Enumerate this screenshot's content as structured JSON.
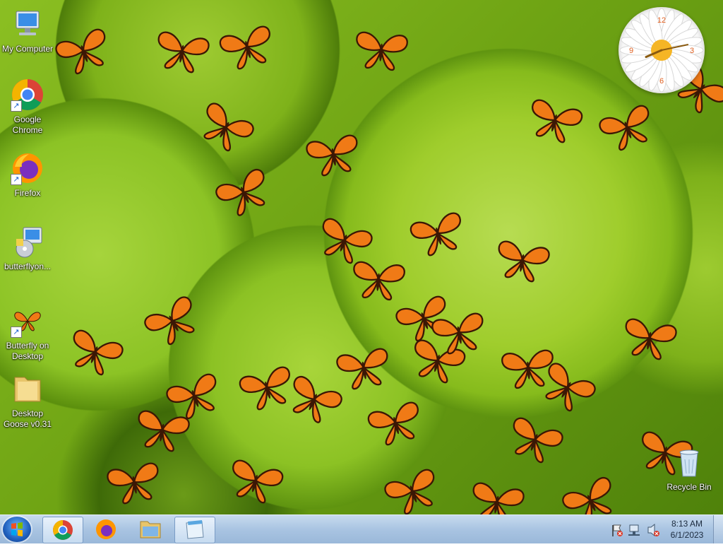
{
  "desktop": {
    "icons": [
      {
        "label": "My Computer",
        "icon": "computer-icon"
      },
      {
        "label": "Google Chrome",
        "icon": "chrome-icon"
      },
      {
        "label": "Firefox",
        "icon": "firefox-icon"
      },
      {
        "label": "butterflyon...",
        "icon": "installer-icon"
      },
      {
        "label": "Butterfly on Desktop",
        "icon": "butterfly-icon"
      },
      {
        "label": "Desktop Goose v0.31",
        "icon": "folder-icon"
      }
    ],
    "recycle_bin": {
      "label": "Recycle Bin",
      "icon": "recycle-bin-icon"
    }
  },
  "clock_widget": {
    "numerals": [
      "12",
      "3",
      "6",
      "9"
    ],
    "time": "8:13"
  },
  "taskbar": {
    "start": {
      "icon": "windows-start-icon"
    },
    "pinned": [
      {
        "name": "Google Chrome",
        "icon": "chrome-icon",
        "active": true
      },
      {
        "name": "Firefox",
        "icon": "firefox-icon",
        "active": false
      },
      {
        "name": "File Explorer",
        "icon": "folder-icon",
        "active": false
      },
      {
        "name": "Notepad",
        "icon": "notepad-icon",
        "active": true
      }
    ],
    "tray": {
      "icons": [
        "action-center-flag-icon",
        "network-icon",
        "volume-muted-icon"
      ],
      "time": "8:13 AM",
      "date": "6/1/2023"
    }
  },
  "colors": {
    "butterfly": "#f07a16",
    "butterfly_vein": "#3b1705",
    "taskbar": "#a9c4e2",
    "wallpaper": "#8bbf22"
  }
}
